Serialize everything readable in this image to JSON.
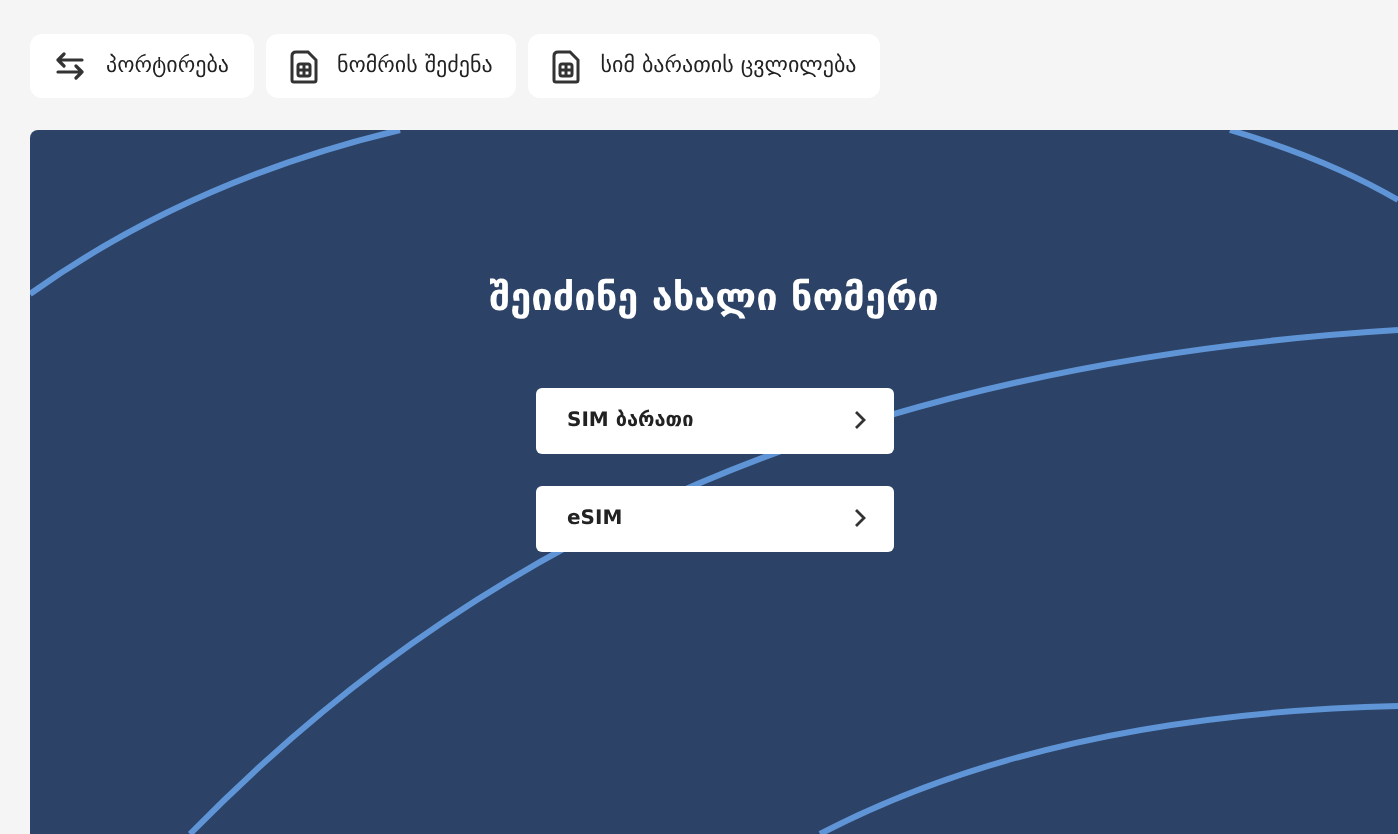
{
  "tabs": [
    {
      "label": "პორტირება",
      "kind": "swap"
    },
    {
      "label": "ნომრის შეძენა",
      "kind": "sim"
    },
    {
      "label": "სიმ ბარათის ცვლილება",
      "kind": "sim"
    }
  ],
  "panel": {
    "title": "შეიძინე ახალი ნომერი",
    "options": [
      {
        "label": "SIM ბარათი"
      },
      {
        "label": "eSIM"
      }
    ]
  }
}
